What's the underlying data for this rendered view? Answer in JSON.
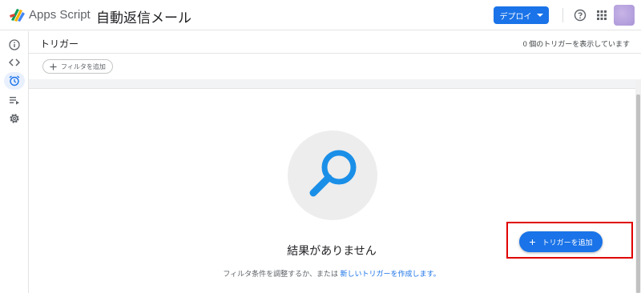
{
  "header": {
    "app_name": "Apps Script",
    "project_title": "自動返信メール",
    "deploy_label": "デプロイ",
    "icons": [
      "apps-script-logo",
      "chevron-down-icon",
      "help-icon",
      "apps-grid-icon",
      "avatar"
    ]
  },
  "sidebar": {
    "items": [
      {
        "name": "overview",
        "icon": "info-icon"
      },
      {
        "name": "editor",
        "icon": "code-icon"
      },
      {
        "name": "triggers",
        "icon": "alarm-clock-icon",
        "active": true
      },
      {
        "name": "executions",
        "icon": "executions-icon"
      },
      {
        "name": "settings",
        "icon": "gear-icon"
      }
    ]
  },
  "triggers": {
    "title": "トリガー",
    "count_text": "0 個のトリガーを表示しています",
    "filter_label": "フィルタを追加"
  },
  "empty_state": {
    "title": "結果がありません",
    "description_prefix": "フィルタ条件を調整するか、または",
    "description_link": "新しいトリガーを作成します。"
  },
  "fab": {
    "label": "トリガーを追加"
  },
  "colors": {
    "accent": "#1a73e8",
    "highlight": "#e00000",
    "illustration": "#1a8fe8"
  }
}
